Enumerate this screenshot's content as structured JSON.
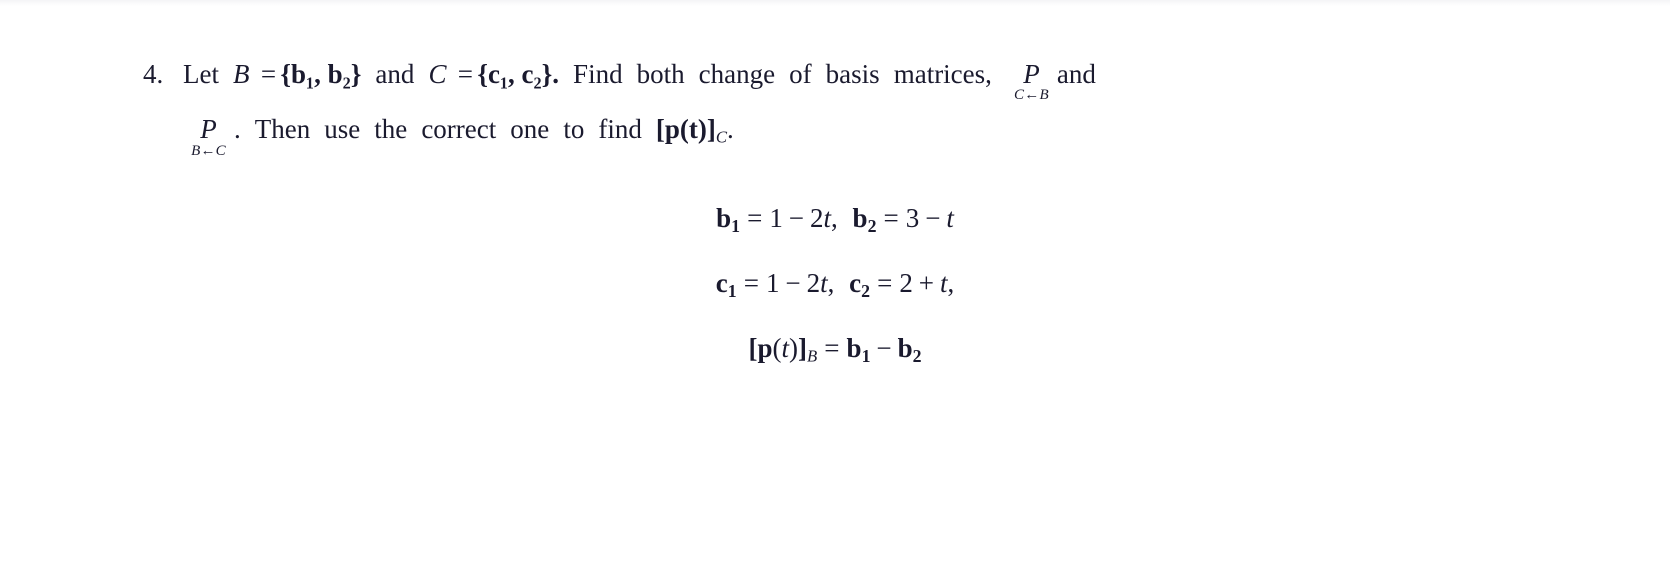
{
  "document": {
    "kind": "math-exercise",
    "text_color": "#1a1a2e",
    "background_color": "#ffffff"
  },
  "problem": {
    "number": "4.",
    "line1": {
      "w_let": "Let",
      "set_b_name": "B",
      "eq1": "=",
      "set_b_value": "{b₁, b₂}",
      "w_and1": "and",
      "set_c_name": "C",
      "eq2": "=",
      "set_c_value": "{c₁, c₂}.",
      "w_find": "Find",
      "w_both": "both",
      "w_change": "change",
      "w_of": "of",
      "w_basis": "basis",
      "w_matrices": "matrices,",
      "matrix1": {
        "symbol": "P",
        "subscript": "C←B"
      },
      "w_and2": "and"
    },
    "line2": {
      "matrix2": {
        "symbol": "P",
        "subscript": "B←C"
      },
      "w_period": ".",
      "w_then": "Then",
      "w_use": "use",
      "w_the": "the",
      "w_correct": "correct",
      "w_one": "one",
      "w_to": "to",
      "w_find": "find",
      "coord_vector": "[p(t)]",
      "coord_subscript": "C",
      "w_end": "."
    }
  },
  "equations": [
    {
      "id": "b-basis",
      "parts": {
        "lhs1": "b",
        "lhs1_sub": "1",
        "eq1": "=",
        "rhs1_a": "1",
        "minus1": "−",
        "rhs1_b": "2",
        "rhs1_var": "t",
        "comma": ",",
        "lhs2": "b",
        "lhs2_sub": "2",
        "eq2": "=",
        "rhs2_a": "3",
        "minus2": "−",
        "rhs2_var": "t"
      },
      "plain": "b₁ = 1 − 2t,  b₂ = 3 − t"
    },
    {
      "id": "c-basis",
      "parts": {
        "lhs1": "c",
        "lhs1_sub": "1",
        "eq1": "=",
        "rhs1_a": "1",
        "minus1": "−",
        "rhs1_b": "2",
        "rhs1_var": "t",
        "comma": ",",
        "lhs2": "c",
        "lhs2_sub": "2",
        "eq2": "=",
        "rhs2_a": "2",
        "plus2": "+",
        "rhs2_var": "t",
        "comma2": ","
      },
      "plain": "c₁ = 1 − 2t,  c₂ = 2 + t,"
    },
    {
      "id": "p-coords",
      "parts": {
        "bracket_open": "[",
        "p": "p",
        "paren_open": "(",
        "var": "t",
        "paren_close": ")",
        "bracket_close": "]",
        "basis_sub": "B",
        "eq": "=",
        "b1": "b",
        "b1_sub": "1",
        "minus": "−",
        "b2": "b",
        "b2_sub": "2"
      },
      "plain": "[p(t)]ₐ = b₁ − b₂"
    }
  ]
}
